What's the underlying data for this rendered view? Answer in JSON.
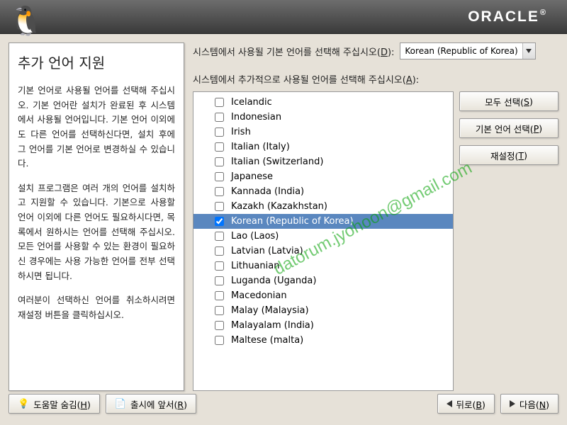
{
  "header": {
    "brand": "ORACLE"
  },
  "left": {
    "title": "추가 언어 지원",
    "p1": "기본 언어로 사용될 언어를 선택해 주십시오. 기본 언어란 설치가 완료된 후 시스템에서 사용될 언어입니다. 기본 언어 이외에도 다른 언어를 선택하신다면, 설치 후에 그 언어를 기본 언어로 변경하실 수 있습니다.",
    "p2": "설치 프로그램은 여러 개의 언어를 설치하고 지원할 수 있습니다. 기본으로 사용할 언어 이외에 다른 언어도 필요하시다면, 목록에서 원하시는 언어를 선택해 주십시오. 모든 언어를 사용할 수 있는 환경이 필요하신 경우에는 사용 가능한 언어를 전부 선택하시면 됩니다.",
    "p3": "여러분이 선택하신 언어를 취소하시려면 재설정 버튼을 클릭하십시오."
  },
  "right": {
    "default_label_pre": "시스템에서 사용될 기본 언어를 선택해 주십시오(",
    "default_label_mn": "D",
    "default_label_post": "):",
    "default_value": "Korean (Republic of Korea)",
    "additional_label_pre": "시스템에서 추가적으로 사용될 언어를 선택해 주십시오(",
    "additional_label_mn": "A",
    "additional_label_post": "):",
    "languages": [
      {
        "label": "Icelandic",
        "checked": false,
        "selected": false
      },
      {
        "label": "Indonesian",
        "checked": false,
        "selected": false
      },
      {
        "label": "Irish",
        "checked": false,
        "selected": false
      },
      {
        "label": "Italian (Italy)",
        "checked": false,
        "selected": false
      },
      {
        "label": "Italian (Switzerland)",
        "checked": false,
        "selected": false
      },
      {
        "label": "Japanese",
        "checked": false,
        "selected": false
      },
      {
        "label": "Kannada (India)",
        "checked": false,
        "selected": false
      },
      {
        "label": "Kazakh (Kazakhstan)",
        "checked": false,
        "selected": false
      },
      {
        "label": "Korean (Republic of Korea)",
        "checked": true,
        "selected": true
      },
      {
        "label": "Lao (Laos)",
        "checked": false,
        "selected": false
      },
      {
        "label": "Latvian (Latvia)",
        "checked": false,
        "selected": false
      },
      {
        "label": "Lithuanian",
        "checked": false,
        "selected": false
      },
      {
        "label": "Luganda (Uganda)",
        "checked": false,
        "selected": false
      },
      {
        "label": "Macedonian",
        "checked": false,
        "selected": false
      },
      {
        "label": "Malay (Malaysia)",
        "checked": false,
        "selected": false
      },
      {
        "label": "Malayalam (India)",
        "checked": false,
        "selected": false
      },
      {
        "label": "Maltese (malta)",
        "checked": false,
        "selected": false
      }
    ],
    "buttons": {
      "select_all_pre": "모두 선택(",
      "select_all_mn": "S",
      "select_all_post": ")",
      "select_default_pre": "기본 언어 선택(",
      "select_default_mn": "P",
      "select_default_post": ")",
      "reset_pre": "재설정(",
      "reset_mn": "T",
      "reset_post": ")"
    }
  },
  "footer": {
    "hide_help_pre": "도움말 숨김(",
    "hide_help_mn": "H",
    "hide_help_post": ")",
    "release_notes_pre": "출시에 앞서(",
    "release_notes_mn": "R",
    "release_notes_post": ")",
    "back_pre": "뒤로(",
    "back_mn": "B",
    "back_post": ")",
    "next_pre": "다음(",
    "next_mn": "N",
    "next_post": ")"
  },
  "watermark": "datorum.jyohoon@gmail.com"
}
